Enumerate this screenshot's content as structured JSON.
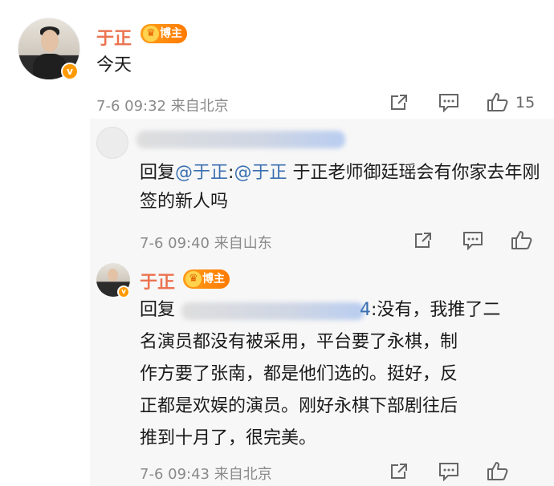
{
  "main_comment": {
    "author": "于正",
    "badge": "博主",
    "verified_mark": "v",
    "text": "今天",
    "time": "7-6 09:32",
    "location": "来自北京",
    "like_count": "15"
  },
  "reply_1": {
    "prefix": "回复",
    "mention_1": "@于正",
    "colon": ":",
    "mention_2": "@于正",
    "text": " 于正老师御廷瑶会有你家去年刚签的新人吗",
    "time": "7-6 09:40",
    "location": "来自山东"
  },
  "reply_2": {
    "author": "于正",
    "badge": "博主",
    "verified_mark": "v",
    "prefix": "回复",
    "mention_tail": "4",
    "line1": ":没有，我推了二",
    "line2": "名演员都没有被采用，平台要了永棋，制",
    "line3": "作方要了张南，都是他们选的。挺好，反",
    "line4": "正都是欢娱的演员。刚好永棋下部剧往后",
    "line5": "推到十月了，很完美。",
    "time": "7-6 09:43",
    "location": "来自北京"
  },
  "icons": [
    "share-icon",
    "comment-icon",
    "like-icon"
  ],
  "colors": {
    "name": "#eb7350",
    "mention": "#3a6fb0",
    "badge": "#ff8a00",
    "meta": "#8a8a8a"
  }
}
